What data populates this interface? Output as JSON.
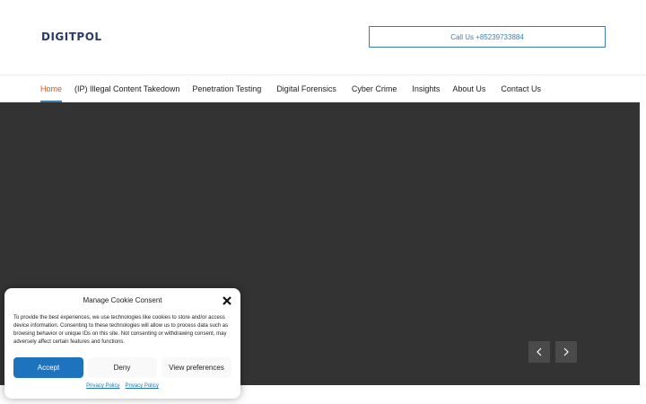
{
  "header": {
    "logo_text": "DIGITPOL",
    "call_button_label": "Call Us +85239733884"
  },
  "nav": {
    "items": [
      {
        "label": "Home",
        "active": true
      },
      {
        "label": "(IP) Illegal Content Takedown",
        "active": false
      },
      {
        "label": "Penetration Testing",
        "active": false
      },
      {
        "label": "Digital Forensics",
        "active": false
      },
      {
        "label": "Cyber Crime",
        "active": false
      },
      {
        "label": "Insights",
        "active": false
      },
      {
        "label": "About Us",
        "active": false
      },
      {
        "label": "Contact Us",
        "active": false
      }
    ]
  },
  "hero": {
    "background": "#333333",
    "prev_icon": "chevron-left-icon",
    "next_icon": "chevron-right-icon"
  },
  "cookie": {
    "title": "Manage Cookie Consent",
    "text": "To provide the best experiences, we use technologies like cookies to store and/or access device information. Consenting to these technologies will allow us to process data such as browsing behavior or unique IDs on this site. Not consenting or withdrawing consent, may adversely affect certain features and functions.",
    "accept_label": "Accept",
    "deny_label": "Deny",
    "preferences_label": "View preferences",
    "links": [
      "Privacy Policy",
      "Privacy Policy"
    ]
  },
  "colors": {
    "accent": "#1e73be",
    "nav_active": "#d2542a",
    "call_border": "#3c7fb1"
  }
}
